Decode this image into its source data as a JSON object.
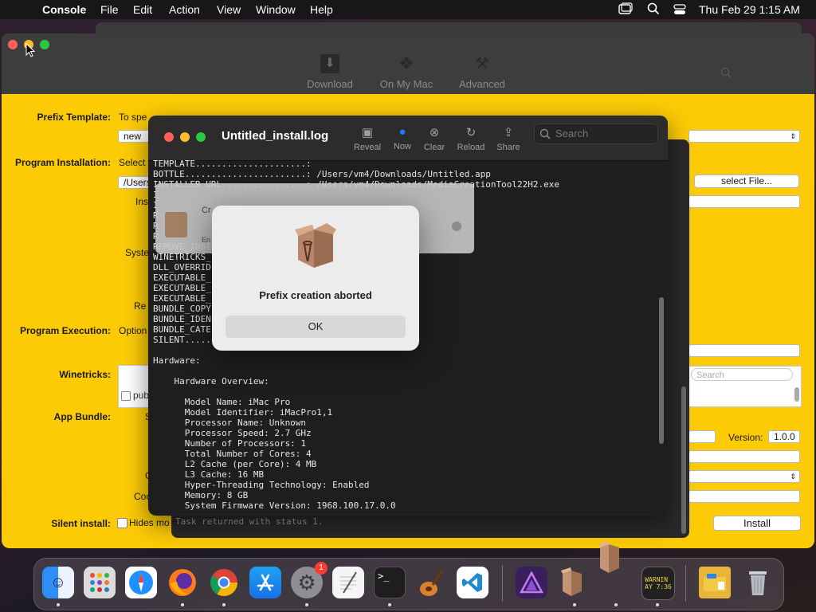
{
  "menubar": {
    "app_name": "Console",
    "items": [
      "File",
      "Edit",
      "Action",
      "View",
      "Window",
      "Help"
    ],
    "clock": "Thu Feb 29  1:15 AM"
  },
  "main_window": {
    "toolbar": {
      "download": "Download",
      "on_my_mac": "On My Mac",
      "advanced": "Advanced"
    },
    "labels": {
      "prefix_template": "Prefix Template:",
      "program_installation": "Program Installation:",
      "program_execution": "Program Execution:",
      "winetricks": "Winetricks:",
      "app_bundle": "App Bundle:",
      "silent_install": "Silent install:"
    },
    "prefix_template_hint": "To spe",
    "prefix_template_select": "new p",
    "program_installation_hint": "Select",
    "program_installation_path": "/Users",
    "frag_ins": "Ins",
    "frag_syste": "Syste",
    "frag_re": "Re",
    "program_execution_hint": "Option",
    "winetricks_pub": "pub",
    "frag_s": "S",
    "frag_c": "C",
    "frag_coo": "Coo",
    "silent_install_hint": "Hides mo",
    "select_file_button": "select File...",
    "search_placeholder": "Search",
    "version_label": "Version:",
    "version_value": "1.0.0",
    "install_button": "Install"
  },
  "console": {
    "title": "Untitled_install.log",
    "tools": [
      {
        "label": "Reveal",
        "icon": "reveal-icon"
      },
      {
        "label": "Now",
        "icon": "now-icon"
      },
      {
        "label": "Clear",
        "icon": "clear-icon"
      },
      {
        "label": "Reload",
        "icon": "reload-icon"
      },
      {
        "label": "Share",
        "icon": "share-icon"
      }
    ],
    "search_placeholder": "Search",
    "log": "TEMPLATE.....................:\nBOTTLE.......................: /Users/vm4/Downloads/Untitled.app\nINSTALLER_URL................: /Users/vm4/Downloads/MediaCreationTool22H2.exe\nI\nI\nR\nR\nR\nREMOVE_INST\nWINETRICKS_\nDLL_OVERRID\nEXECUTABLE_\nEXECUTABLE_\nEXECUTABLE_\nBUNDLE_COPY\nBUNDLE_IDEN                             urapp\nBUNDLE_CATE                             y.business\nSILENT........................\n\nHardware:\n\n    Hardware Overview:\n\n      Model Name: iMac Pro\n      Model Identifier: iMacPro1,1\n      Processor Name: Unknown\n      Processor Speed: 2.7 GHz\n      Number of Processors: 1\n      Total Number of Cores: 4\n      L2 Cache (per Core): 4 MB\n      L3 Cache: 16 MB\n      Hyper-Threading Technology: Enabled\n      Memory: 8 GB\n      System Firmware Version: 1968.100.17.0.0",
    "status": "Task returned with status 1."
  },
  "progress_sheet": {
    "title_fragment": "Cr",
    "sub_fragment": "En"
  },
  "alert": {
    "message": "Prefix creation aborted",
    "ok_label": "OK"
  },
  "dock": {
    "apps": [
      "finder",
      "launchpad",
      "safari",
      "firefox",
      "chrome",
      "app-store",
      "system-settings",
      "textedit",
      "terminal",
      "garageband",
      "vscode",
      "affinity",
      "wineskin",
      "wineskin-drag",
      "console",
      "finder-folder",
      "trash"
    ],
    "settings_badge": "1",
    "console_text": "WARNIN\nAY 7:36"
  },
  "colors": {
    "accent_yellow": "#fccb06",
    "console_bg": "#1e1e1e"
  }
}
